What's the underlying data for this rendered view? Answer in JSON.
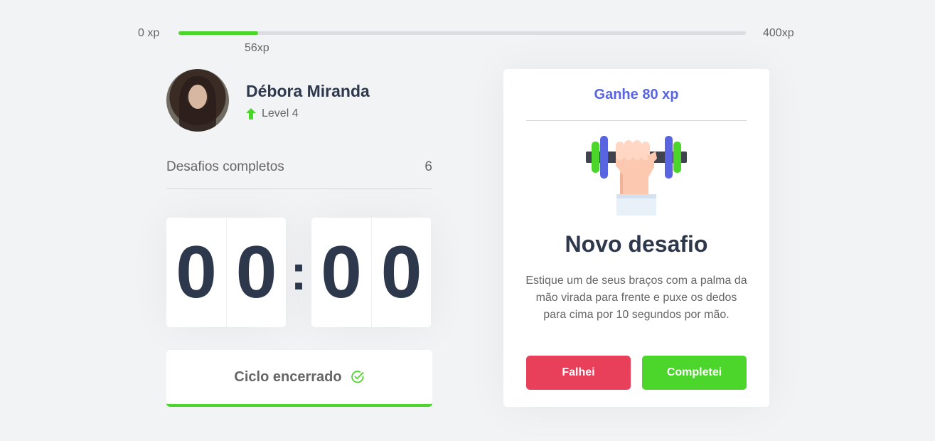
{
  "xp": {
    "min_label": "0 xp",
    "max_label": "400xp",
    "current_label": "56xp",
    "progress_fraction": 0.14
  },
  "profile": {
    "name": "Débora Miranda",
    "level": "Level 4"
  },
  "stats": {
    "completed_label": "Desafios completos",
    "completed_value": "6"
  },
  "countdown": {
    "minute_left": "0",
    "minute_right": "0",
    "separator": ":",
    "second_left": "0",
    "second_right": "0"
  },
  "cycle_button": {
    "label": "Ciclo encerrado",
    "icon": "check-circle-icon"
  },
  "challenge": {
    "reward": "Ganhe 80 xp",
    "title": "Novo desafio",
    "description": "Estique um de seus braços com a palma da mão virada para frente e puxe os dedos para cima por 10 segundos por mão.",
    "fail_label": "Falhei",
    "success_label": "Completei",
    "icon": "dumbbell-icon"
  },
  "colors": {
    "green": "#4cd62b",
    "red": "#e83f5b",
    "blue": "#5965e0",
    "title": "#2e384d",
    "text": "#666666",
    "background": "#f2f3f5"
  }
}
